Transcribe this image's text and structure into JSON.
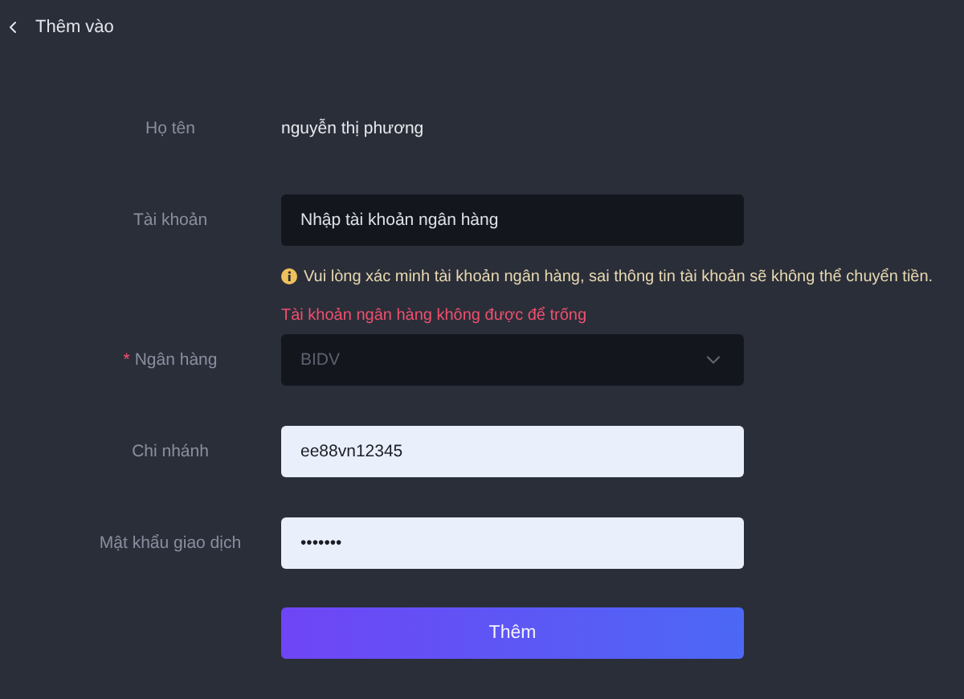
{
  "header": {
    "title": "Thêm vào"
  },
  "fields": [
    {
      "kind": "text",
      "label": "Họ tên",
      "value": "nguyễn thị phương"
    },
    {
      "kind": "input",
      "label": "Tài khoản",
      "placeholder": "Nhập tài khoản ngân hàng",
      "hint": "Vui lòng xác minh tài khoản ngân hàng, sai thông tin tài khoản sẽ không thể chuyển tiền.",
      "error": "Tài khoản ngân hàng không được để trống"
    },
    {
      "kind": "select",
      "label": "Ngân hàng",
      "required_mark": "*",
      "value": "BIDV",
      "disabled": true
    },
    {
      "kind": "filled",
      "label": "Chi nhánh",
      "value": "ee88vn12345"
    },
    {
      "kind": "filled",
      "label": "Mật khẩu giao dịch",
      "value": "•••••••"
    }
  ],
  "submit": {
    "label": "Thêm"
  }
}
